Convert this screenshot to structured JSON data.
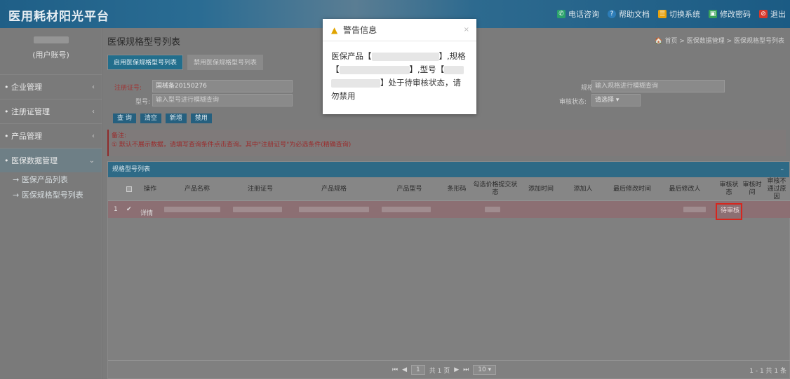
{
  "app": {
    "title": "医用耗材阳光平台",
    "nav": [
      {
        "label": "电话咨询",
        "icon": "phone-icon",
        "color": "#2aa26b"
      },
      {
        "label": "帮助文档",
        "icon": "help-icon",
        "color": "#2d7db8"
      },
      {
        "label": "切换系统",
        "icon": "switch-icon",
        "color": "#e8a20c"
      },
      {
        "label": "修改密码",
        "icon": "lock-icon",
        "color": "#3aa35a"
      },
      {
        "label": "退出",
        "icon": "logout-icon",
        "color": "#d7382c"
      }
    ]
  },
  "sidebar": {
    "user_label": "(用户账号)",
    "menu": [
      {
        "label": "企业管理",
        "arrow": "‹"
      },
      {
        "label": "注册证管理",
        "arrow": "‹"
      },
      {
        "label": "产品管理",
        "arrow": "‹"
      },
      {
        "label": "医保数据管理",
        "arrow": "⌄"
      }
    ],
    "sub_items": [
      {
        "label": "医保产品列表"
      },
      {
        "label": "医保规格型号列表"
      }
    ]
  },
  "page": {
    "title": "医保规格型号列表",
    "breadcrumb": "🏠 首页 > 医保数据管理 > 医保规格型号列表",
    "tabs": [
      "启用医保规格型号列表",
      "禁用医保规格型号列表"
    ]
  },
  "filters": {
    "reg_no_label": "注册证号:",
    "reg_no_value": "国械备20150276",
    "model_label": "型号:",
    "model_placeholder": "输入型号进行模糊查询",
    "spec_label": "规格:",
    "spec_placeholder": "输入规格进行模糊查询",
    "status_label": "审核状态:",
    "status_value": "请选择"
  },
  "actions": [
    "查 询",
    "清空",
    "新增",
    "禁用"
  ],
  "note": {
    "title": "备注:",
    "line1": "① 默认不展示数据，请填写查询条件点击查询。其中\"注册证号\"为必选条件(精确查询)"
  },
  "table": {
    "panel_title": "规格型号列表",
    "headers": [
      "操作",
      "产品名称",
      "注册证号",
      "产品规格",
      "产品型号",
      "条形码",
      "勾选价格提交状态",
      "添加时间",
      "添加人",
      "最后修改时间",
      "最后修改人",
      "审核状态",
      "审核时间",
      "审核不通过原因"
    ],
    "rows": [
      {
        "index": "1",
        "check": "✔",
        "action": "详情",
        "status": "待审核"
      }
    ]
  },
  "pager": {
    "page": "1",
    "total_pages": "共 1 页",
    "page_size": "10 ▾",
    "summary": "1 - 1 共 1 条"
  },
  "modal": {
    "title": "警告信息",
    "close": "×",
    "text1": "医保产品【",
    "text2": "】,规格",
    "text3": "【",
    "text4": "】,型号【",
    "text5": "】处于待审核状态，请勿禁用"
  }
}
